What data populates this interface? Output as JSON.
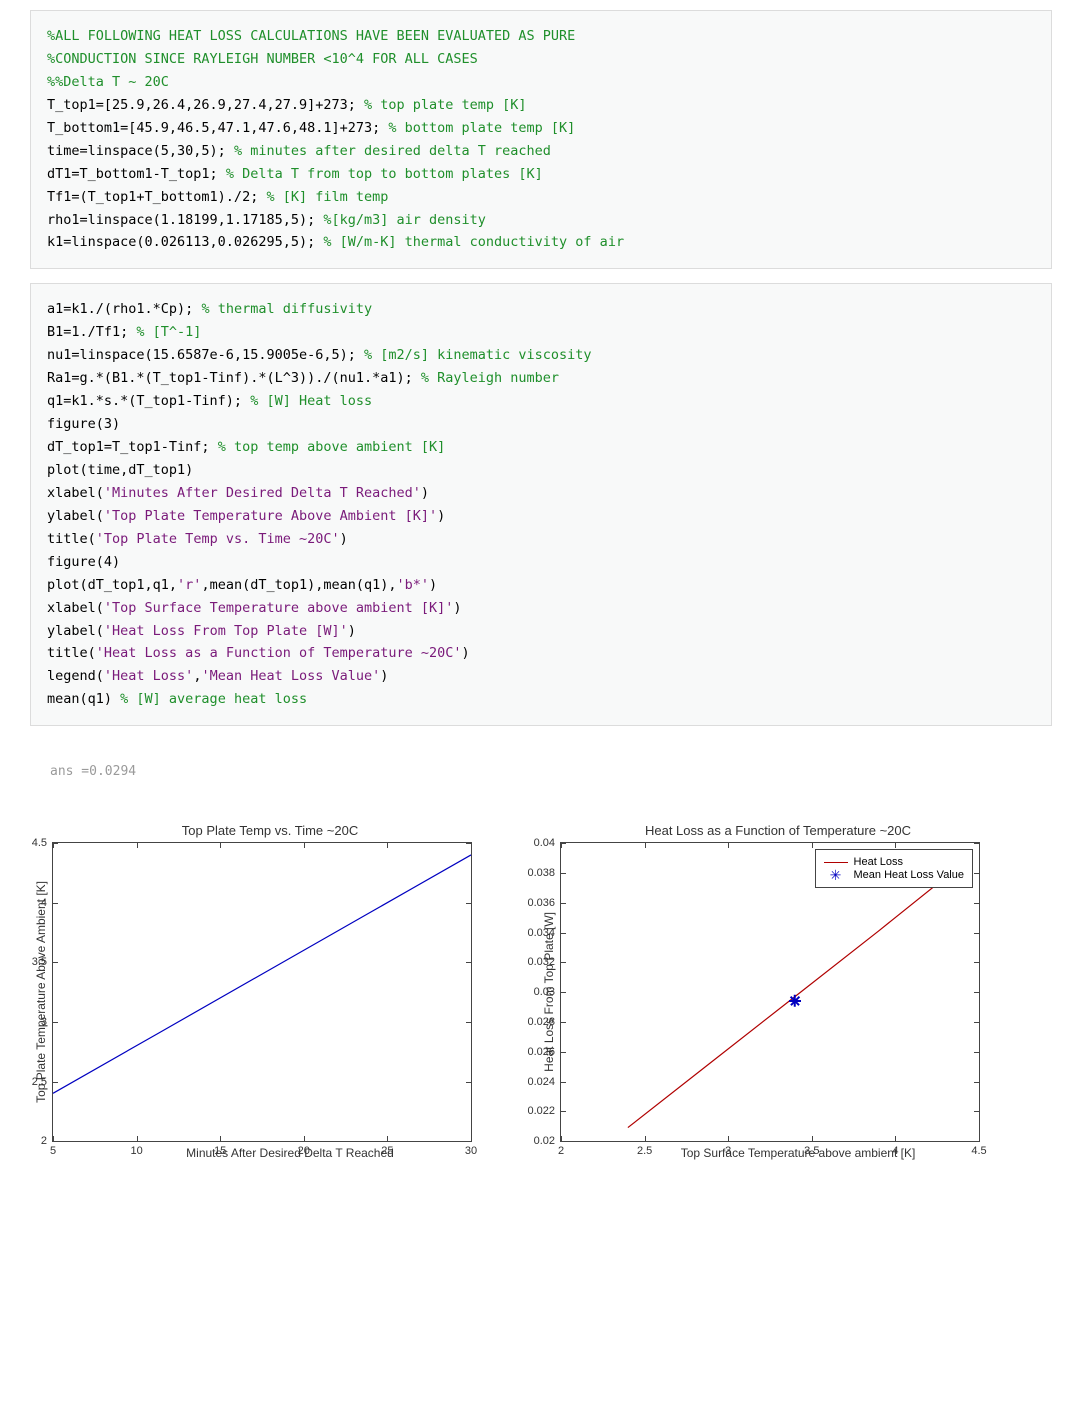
{
  "block1": {
    "lines": [
      {
        "segs": [
          {
            "t": "c",
            "v": "%ALL FOLLOWING HEAT LOSS CALCULATIONS HAVE BEEN EVALUATED AS PURE"
          }
        ]
      },
      {
        "segs": [
          {
            "t": "c",
            "v": "%CONDUCTION SINCE RAYLEIGH NUMBER <10^4 FOR ALL CASES"
          }
        ]
      },
      {
        "segs": [
          {
            "t": "c",
            "v": "%%Delta T ~ 20C"
          }
        ]
      },
      {
        "segs": [
          {
            "t": "k",
            "v": "T_top1=[25.9,26.4,26.9,27.4,27.9]+273; "
          },
          {
            "t": "c",
            "v": "% top plate temp [K]"
          }
        ]
      },
      {
        "segs": [
          {
            "t": "k",
            "v": "T_bottom1=[45.9,46.5,47.1,47.6,48.1]+273; "
          },
          {
            "t": "c",
            "v": "% bottom plate temp [K]"
          }
        ]
      },
      {
        "segs": [
          {
            "t": "k",
            "v": "time=linspace(5,30,5); "
          },
          {
            "t": "c",
            "v": "% minutes after desired delta T reached"
          }
        ]
      },
      {
        "segs": [
          {
            "t": "k",
            "v": "dT1=T_bottom1-T_top1; "
          },
          {
            "t": "c",
            "v": "% Delta T from top to bottom plates [K]"
          }
        ]
      },
      {
        "segs": [
          {
            "t": "k",
            "v": "Tf1=(T_top1+T_bottom1)./2; "
          },
          {
            "t": "c",
            "v": "% [K] film temp"
          }
        ]
      },
      {
        "segs": [
          {
            "t": "k",
            "v": "rho1=linspace(1.18199,1.17185,5); "
          },
          {
            "t": "c",
            "v": "%[kg/m3] air density"
          }
        ]
      },
      {
        "segs": [
          {
            "t": "k",
            "v": "k1=linspace(0.026113,0.026295,5); "
          },
          {
            "t": "c",
            "v": "% [W/m-K] thermal conductivity of air"
          }
        ]
      }
    ]
  },
  "block2": {
    "lines": [
      {
        "segs": [
          {
            "t": "k",
            "v": "a1=k1./(rho1.*Cp); "
          },
          {
            "t": "c",
            "v": "% thermal diffusivity"
          }
        ]
      },
      {
        "segs": [
          {
            "t": "k",
            "v": "B1=1./Tf1; "
          },
          {
            "t": "c",
            "v": "% [T^-1]"
          }
        ]
      },
      {
        "segs": [
          {
            "t": "k",
            "v": "nu1=linspace(15.6587e-6,15.9005e-6,5); "
          },
          {
            "t": "c",
            "v": "% [m2/s] kinematic viscosity"
          }
        ]
      },
      {
        "segs": [
          {
            "t": "k",
            "v": "Ra1=g.*(B1.*(T_top1-Tinf).*(L^3))./(nu1.*a1); "
          },
          {
            "t": "c",
            "v": "% Rayleigh number"
          }
        ]
      },
      {
        "segs": [
          {
            "t": "k",
            "v": "q1=k1.*s.*(T_top1-Tinf); "
          },
          {
            "t": "c",
            "v": "% [W] Heat loss"
          }
        ]
      },
      {
        "segs": [
          {
            "t": "k",
            "v": "figure(3)"
          }
        ]
      },
      {
        "segs": [
          {
            "t": "k",
            "v": "dT_top1=T_top1-Tinf; "
          },
          {
            "t": "c",
            "v": "% top temp above ambient [K]"
          }
        ]
      },
      {
        "segs": [
          {
            "t": "k",
            "v": "plot(time,dT_top1)"
          }
        ]
      },
      {
        "segs": [
          {
            "t": "k",
            "v": "xlabel("
          },
          {
            "t": "s",
            "v": "'Minutes After Desired Delta T Reached'"
          },
          {
            "t": "k",
            "v": ")"
          }
        ]
      },
      {
        "segs": [
          {
            "t": "k",
            "v": "ylabel("
          },
          {
            "t": "s",
            "v": "'Top Plate Temperature Above Ambient [K]'"
          },
          {
            "t": "k",
            "v": ")"
          }
        ]
      },
      {
        "segs": [
          {
            "t": "k",
            "v": "title("
          },
          {
            "t": "s",
            "v": "'Top Plate Temp vs. Time ~20C'"
          },
          {
            "t": "k",
            "v": ")"
          }
        ]
      },
      {
        "segs": [
          {
            "t": "k",
            "v": "figure(4)"
          }
        ]
      },
      {
        "segs": [
          {
            "t": "k",
            "v": "plot(dT_top1,q1,"
          },
          {
            "t": "s",
            "v": "'r'"
          },
          {
            "t": "k",
            "v": ",mean(dT_top1),mean(q1),"
          },
          {
            "t": "s",
            "v": "'b*'"
          },
          {
            "t": "k",
            "v": ")"
          }
        ]
      },
      {
        "segs": [
          {
            "t": "k",
            "v": "xlabel("
          },
          {
            "t": "s",
            "v": "'Top Surface Temperature above ambient [K]'"
          },
          {
            "t": "k",
            "v": ")"
          }
        ]
      },
      {
        "segs": [
          {
            "t": "k",
            "v": "ylabel("
          },
          {
            "t": "s",
            "v": "'Heat Loss From Top Plate [W]'"
          },
          {
            "t": "k",
            "v": ")"
          }
        ]
      },
      {
        "segs": [
          {
            "t": "k",
            "v": "title("
          },
          {
            "t": "s",
            "v": "'Heat Loss as a Function of Temperature ~20C'"
          },
          {
            "t": "k",
            "v": ")"
          }
        ]
      },
      {
        "segs": [
          {
            "t": "k",
            "v": "legend("
          },
          {
            "t": "s",
            "v": "'Heat Loss'"
          },
          {
            "t": "k",
            "v": ","
          },
          {
            "t": "s",
            "v": "'Mean Heat Loss Value'"
          },
          {
            "t": "k",
            "v": ")"
          }
        ]
      },
      {
        "segs": [
          {
            "t": "k",
            "v": "mean(q1) "
          },
          {
            "t": "c",
            "v": "% [W] average heat loss"
          }
        ]
      }
    ]
  },
  "output": {
    "text": "ans =0.0294"
  },
  "plot_left": {
    "title": "Top Plate Temp vs. Time ~20C",
    "xlabel": "Minutes After Desired Delta T Reached",
    "ylabel": "Top Plate Temperature Above Ambient [K]",
    "xticks_labels": [
      "5",
      "10",
      "15",
      "20",
      "25",
      "30"
    ]
  },
  "plot_right": {
    "title": "Heat Loss as a Function of Temperature ~20C",
    "xlabel": "Top Surface Temperature above ambient [K]",
    "ylabel": "Heat Loss From Top Plate [W]",
    "legend1": "Heat Loss",
    "legend2": "Mean Heat Loss Value"
  },
  "chart_data": [
    {
      "type": "line",
      "title": "Top Plate Temp vs. Time ~20C",
      "xlabel": "Minutes After Desired Delta T Reached",
      "ylabel": "Top Plate Temperature Above Ambient [K]",
      "x": [
        5.0,
        11.25,
        17.5,
        23.75,
        30.0
      ],
      "y": [
        2.4,
        2.9,
        3.4,
        3.9,
        4.4
      ],
      "xlim": [
        5,
        30
      ],
      "ylim": [
        2,
        4.5
      ],
      "xticks": [
        5,
        10,
        15,
        20,
        25,
        30
      ],
      "yticks": [
        2,
        2.5,
        3,
        3.5,
        4,
        4.5
      ],
      "line_color": "#0000c0"
    },
    {
      "type": "line+scatter",
      "title": "Heat Loss as a Function of Temperature ~20C",
      "xlabel": "Top Surface Temperature above ambient [K]",
      "ylabel": "Heat Loss From Top Plate [W]",
      "series": [
        {
          "name": "Heat Loss",
          "type": "line",
          "x": [
            2.4,
            2.9,
            3.4,
            3.9,
            4.4
          ],
          "y": [
            0.0209,
            0.0253,
            0.0297,
            0.0341,
            0.0386
          ],
          "color": "#b00000"
        },
        {
          "name": "Mean Heat Loss Value",
          "type": "scatter",
          "x": [
            3.4
          ],
          "y": [
            0.0294
          ],
          "marker": "*",
          "color": "#0000c0"
        }
      ],
      "xlim": [
        2,
        4.5
      ],
      "ylim": [
        0.02,
        0.04
      ],
      "xticks": [
        2,
        2.5,
        3,
        3.5,
        4,
        4.5
      ],
      "yticks": [
        0.02,
        0.022,
        0.024,
        0.026,
        0.028,
        0.03,
        0.032,
        0.034,
        0.036,
        0.038,
        0.04
      ],
      "legend_position": "top-right"
    }
  ]
}
